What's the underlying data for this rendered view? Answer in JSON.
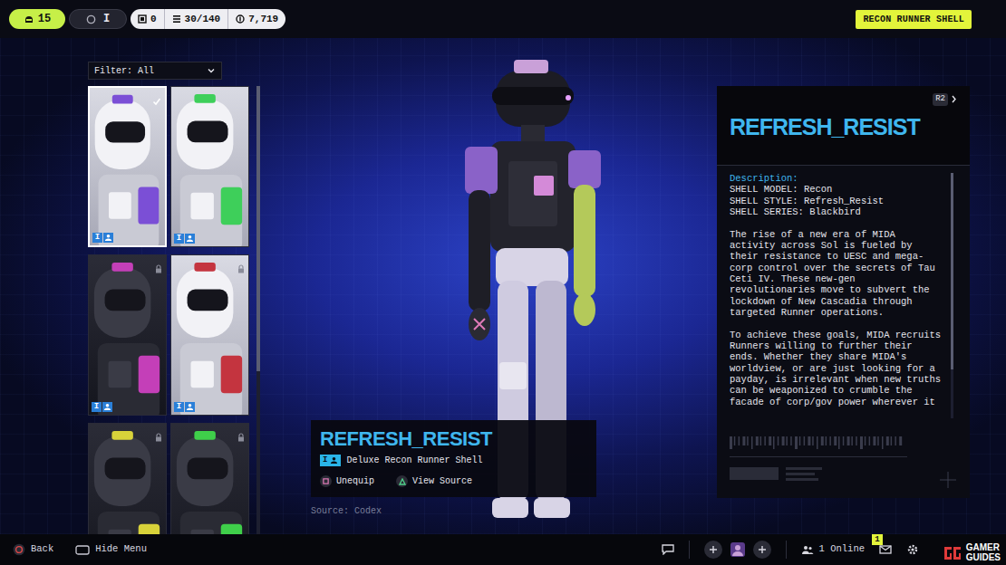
{
  "top_bar": {
    "level": "15",
    "rank": "I",
    "counters": [
      "0",
      "30/140",
      "7,719"
    ],
    "mode_button": "RECON RUNNER SHELL"
  },
  "filter": {
    "label": "Filter: All",
    "expanded": false
  },
  "shells": [
    {
      "selected": true,
      "locked": false,
      "tag": "I",
      "kind": "light",
      "color": "#7b4fd6"
    },
    {
      "selected": false,
      "locked": false,
      "tag": "I",
      "kind": "light",
      "color": "#3ecf5a"
    },
    {
      "selected": false,
      "locked": true,
      "tag": "I",
      "kind": "dark",
      "color": "#c43fb8"
    },
    {
      "selected": false,
      "locked": true,
      "tag": "I",
      "kind": "light",
      "color": "#c4343f"
    },
    {
      "selected": false,
      "locked": true,
      "kind": "dark",
      "color": "#d8d23a"
    },
    {
      "selected": false,
      "locked": true,
      "kind": "dark",
      "color": "#3fcf4a"
    }
  ],
  "preview": {
    "title": "REFRESH_RESIST",
    "tier": "I",
    "type": "Deluxe Recon Runner Shell",
    "actions": [
      {
        "label": "Unequip",
        "kind": "square"
      },
      {
        "label": "View Source",
        "kind": "triangle"
      }
    ],
    "source": "Source: Codex"
  },
  "details": {
    "hint": "R2",
    "title": "REFRESH_RESIST",
    "section": "Description:",
    "specs": [
      "SHELL MODEL: Recon",
      "SHELL STYLE: Refresh_Resist",
      "SHELL SERIES: Blackbird"
    ],
    "paragraphs": [
      "The rise of a new era of MIDA activity across Sol is fueled by their resistance to UESC and mega-corp control over the secrets of Tau Ceti IV. These new-gen revolutionaries move to subvert the lockdown of New Cascadia through targeted Runner operations.",
      "To achieve these goals, MIDA recruits Runners willing to further their ends. Whether they share MIDA's worldview, or are just looking for a payday, is irrelevant when new truths can be weaponized to crumble the facade of corp/gov power wherever it"
    ]
  },
  "bottom_bar": {
    "back": "Back",
    "hide_menu": "Hide Menu",
    "online": "1 Online",
    "badge": "1"
  },
  "watermark": [
    "GAMER",
    "GUIDES"
  ]
}
